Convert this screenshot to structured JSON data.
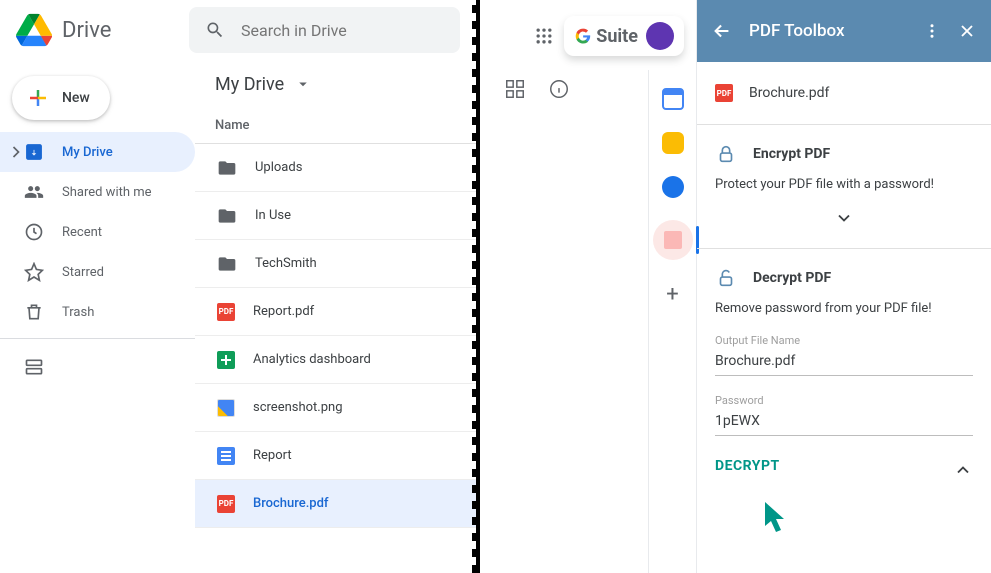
{
  "drive": {
    "title": "Drive",
    "search_placeholder": "Search in Drive",
    "new_label": "New",
    "nav": [
      {
        "label": "My Drive",
        "icon": "my-drive",
        "active": true,
        "chevron": true
      },
      {
        "label": "Shared with me",
        "icon": "shared"
      },
      {
        "label": "Recent",
        "icon": "recent"
      },
      {
        "label": "Starred",
        "icon": "starred"
      },
      {
        "label": "Trash",
        "icon": "trash"
      }
    ],
    "path": "My Drive",
    "col_name": "Name",
    "files": [
      {
        "name": "Uploads",
        "type": "folder"
      },
      {
        "name": "In Use",
        "type": "folder"
      },
      {
        "name": "TechSmith",
        "type": "folder"
      },
      {
        "name": "Report.pdf",
        "type": "pdf"
      },
      {
        "name": "Analytics dashboard",
        "type": "sheet"
      },
      {
        "name": "screenshot.png",
        "type": "img"
      },
      {
        "name": "Report",
        "type": "doc"
      },
      {
        "name": "Brochure.pdf",
        "type": "pdf",
        "selected": true
      }
    ],
    "gsuite_label": "Suite"
  },
  "toolbox": {
    "title": "PDF Toolbox",
    "file_name": "Brochure.pdf",
    "encrypt": {
      "title": "Encrypt PDF",
      "desc": "Protect your PDF file with a password!"
    },
    "decrypt": {
      "title": "Decrypt PDF",
      "desc": "Remove password from your PDF file!",
      "out_label": "Output File Name",
      "out_value": "Brochure.pdf",
      "pw_label": "Password",
      "pw_value": "1pEWX",
      "action": "DECRYPT"
    }
  }
}
